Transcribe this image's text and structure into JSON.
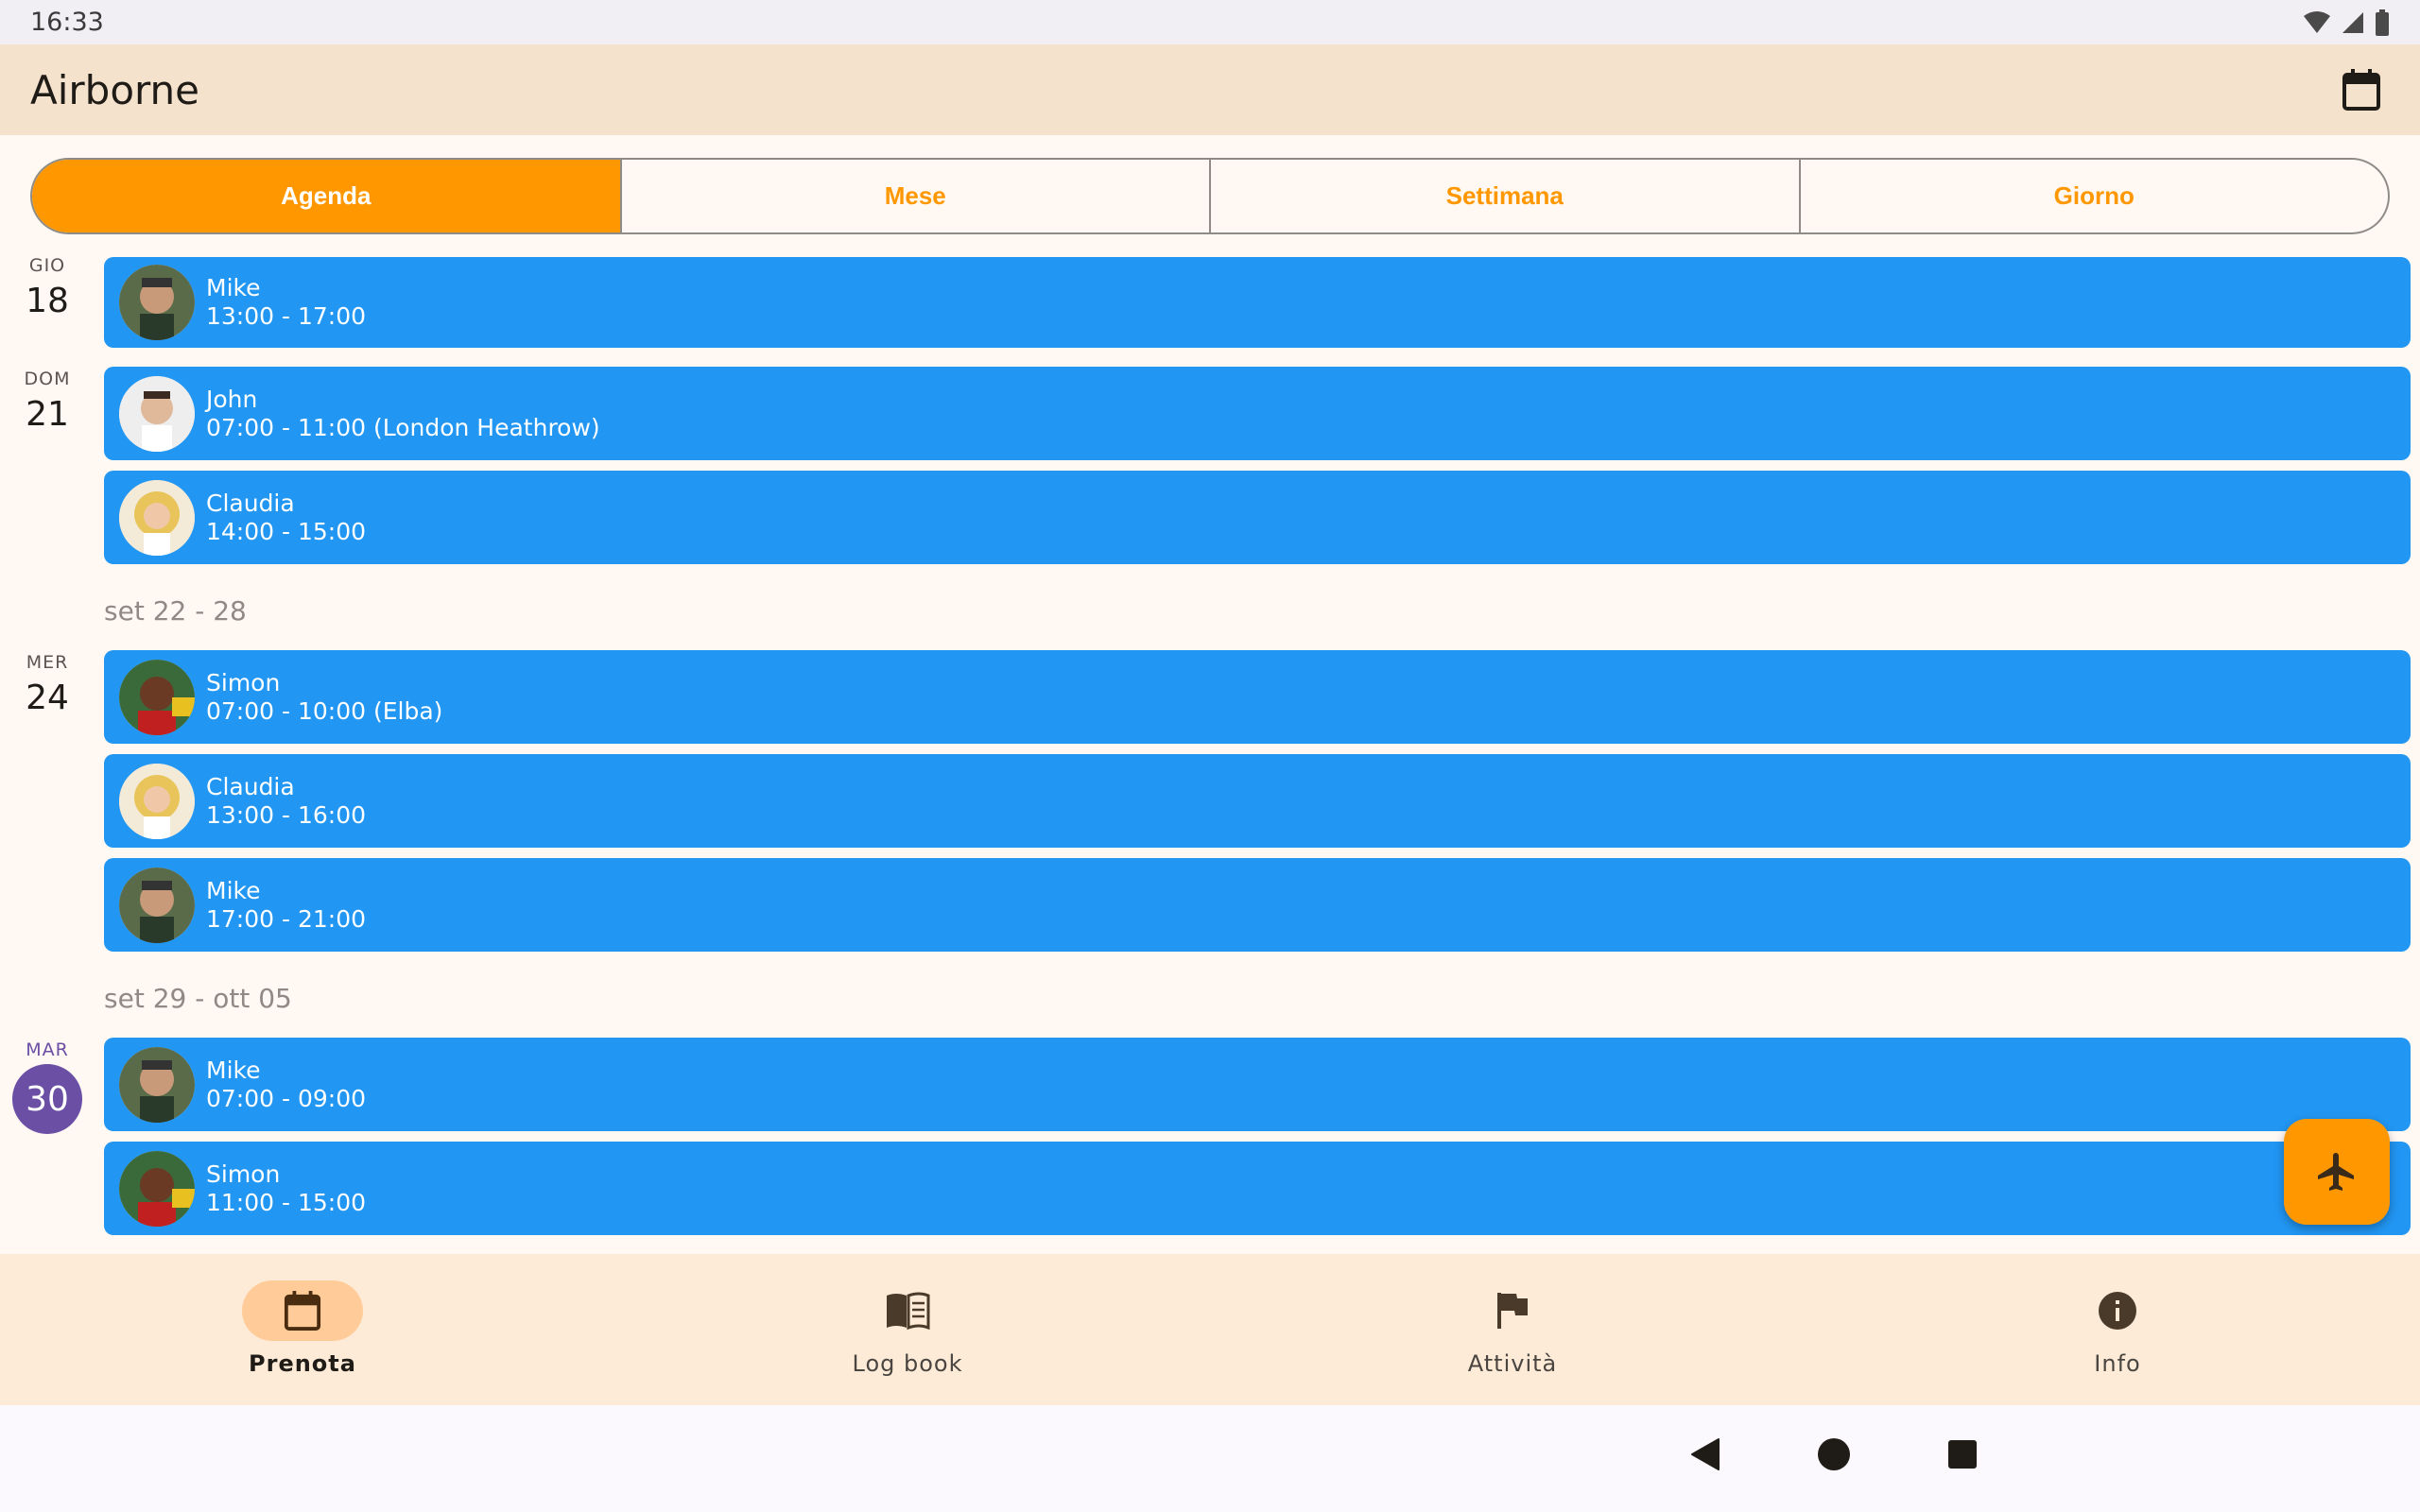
{
  "status_bar": {
    "time": "16:33"
  },
  "app_bar": {
    "title": "Airborne",
    "calendar_icon": "calendar-icon"
  },
  "tabs": [
    {
      "label": "Agenda",
      "active": true
    },
    {
      "label": "Mese",
      "active": false
    },
    {
      "label": "Settimana",
      "active": false
    },
    {
      "label": "Giorno",
      "active": false
    }
  ],
  "colors": {
    "accent": "#ff9800",
    "event": "#2196f3",
    "today": "#6b4fa5",
    "app_bar": "#f5e2cd",
    "nav_bg": "#fdebd8"
  },
  "agenda": {
    "days": [
      {
        "dow": "GIO",
        "day": "18"
      },
      {
        "dow": "DOM",
        "day": "21"
      },
      {
        "dow": "MER",
        "day": "24"
      },
      {
        "dow": "MAR",
        "day": "30",
        "today": true
      }
    ],
    "week_headers": [
      "set 22 - 28",
      "set 29 - ott 05"
    ],
    "events": [
      {
        "name": "Mike",
        "time": "13:00 - 17:00"
      },
      {
        "name": "John",
        "time": "07:00 - 11:00 (London Heathrow)"
      },
      {
        "name": "Claudia",
        "time": "14:00 - 15:00"
      },
      {
        "name": "Simon",
        "time": "07:00 - 10:00 (Elba)"
      },
      {
        "name": "Claudia",
        "time": "13:00 - 16:00"
      },
      {
        "name": "Mike",
        "time": "17:00 - 21:00"
      },
      {
        "name": "Mike",
        "time": "07:00 - 09:00"
      },
      {
        "name": "Simon",
        "time": "11:00 - 15:00"
      }
    ]
  },
  "fab": {
    "icon": "airplane-icon"
  },
  "bottom_nav": [
    {
      "label": "Prenota",
      "icon": "calendar-icon",
      "active": true
    },
    {
      "label": "Log book",
      "icon": "book-icon",
      "active": false
    },
    {
      "label": "Attività",
      "icon": "flag-icon",
      "active": false
    },
    {
      "label": "Info",
      "icon": "info-icon",
      "active": false
    }
  ]
}
